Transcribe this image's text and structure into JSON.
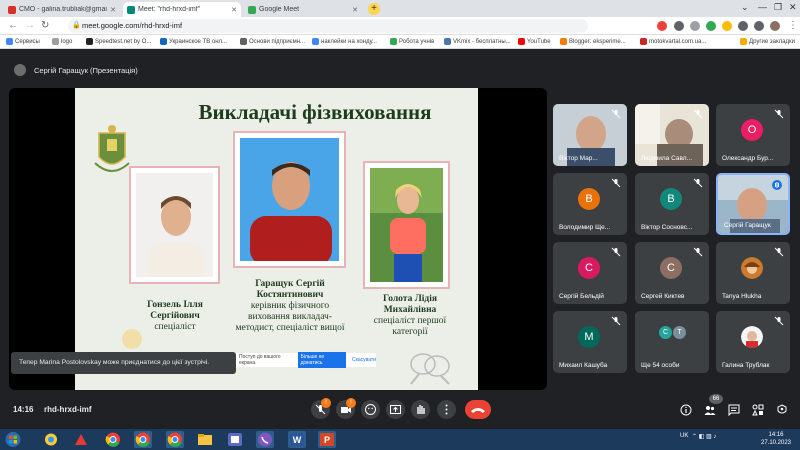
{
  "browser": {
    "tabs": [
      {
        "label": "СМО - galina.trubliak@gmail.co",
        "close": "✕",
        "icon_color": "#d93025"
      },
      {
        "label": "Meet: \"rhd-hrxd-imf\"",
        "close": "✕",
        "icon_color": "#00897b"
      },
      {
        "label": "Google Meet",
        "close": "✕",
        "icon_color": "#34a853"
      }
    ],
    "new_tab": "+",
    "url": "meet.google.com/rhd-hrxd-imf",
    "bookmarks": [
      "Сервисы",
      "logo",
      "Speedtest.net by O...",
      "Украинское ТВ онл...",
      "Основи підприємн...",
      "наклейки на хонду...",
      "Робота учнів",
      "VKmix - бесплатны...",
      "YouTube",
      "Blogger: eksperime...",
      "motokvartal.com.ua...",
      "Другие закладки"
    ]
  },
  "meet": {
    "presenter": "Сергій Гаращук (Презентація)",
    "slide": {
      "title": "Викладачі фізвиховання",
      "teachers": [
        {
          "name1": "Гонзель Ілля",
          "name2": "Сергійович",
          "role": "спеціаліст"
        },
        {
          "name1": "Гаращук Сергій",
          "name2": "Костянтинович",
          "role": "керівник фізичного виховання викладач-методист, спеціаліст вищої"
        },
        {
          "name1": "Голота Лідія",
          "name2": "Михайлівна",
          "role": "спеціаліст першої категорії"
        }
      ]
    },
    "toast": "Тепер Marina Postolovskay може приєднатися до цієї зустрічі.",
    "translate_bar": {
      "text": "Поступ до вашого екрана.",
      "button": "Більше не дізнатись",
      "link": "Скасувати"
    },
    "participants": [
      {
        "name": "Віктор Мар...",
        "initial": "",
        "color": "#5f6368",
        "video": true
      },
      {
        "name": "Людмила Савл...",
        "initial": "",
        "color": "#5f6368",
        "video": true
      },
      {
        "name": "Олександр Бур...",
        "initial": "О",
        "color": "#e91e63",
        "video": false
      },
      {
        "name": "Володимир Ще...",
        "initial": "В",
        "color": "#e8710a",
        "video": false
      },
      {
        "name": "Віктор Сосновс...",
        "initial": "В",
        "color": "#12877b",
        "video": false
      },
      {
        "name": "Сергій Гаращук",
        "initial": "",
        "color": "#5f6368",
        "video": true
      },
      {
        "name": "Сергій Бельдій",
        "initial": "С",
        "color": "#d81b60",
        "video": false
      },
      {
        "name": "Сергей Киктев",
        "initial": "С",
        "color": "#8d6e63",
        "video": false
      },
      {
        "name": "Tanya Hlukha",
        "initial": "",
        "color": "#3c4043",
        "video": false
      },
      {
        "name": "Михаил Кашуба",
        "initial": "М",
        "color": "#00695c",
        "video": false
      },
      {
        "name": "Ще 54 особи",
        "initial": "С Т",
        "color": "#3c4043",
        "video": false
      },
      {
        "name": "Галина Трублак",
        "initial": "",
        "color": "#3c4043",
        "video": false
      }
    ],
    "time": "14:16",
    "meeting_code": "rhd-hrxd-imf",
    "people_count": "66",
    "mic_badge": "!",
    "cam_badge": "!"
  },
  "taskbar": {
    "lang": "UK",
    "clock_time": "14:16",
    "clock_date": "27.10.2023"
  }
}
